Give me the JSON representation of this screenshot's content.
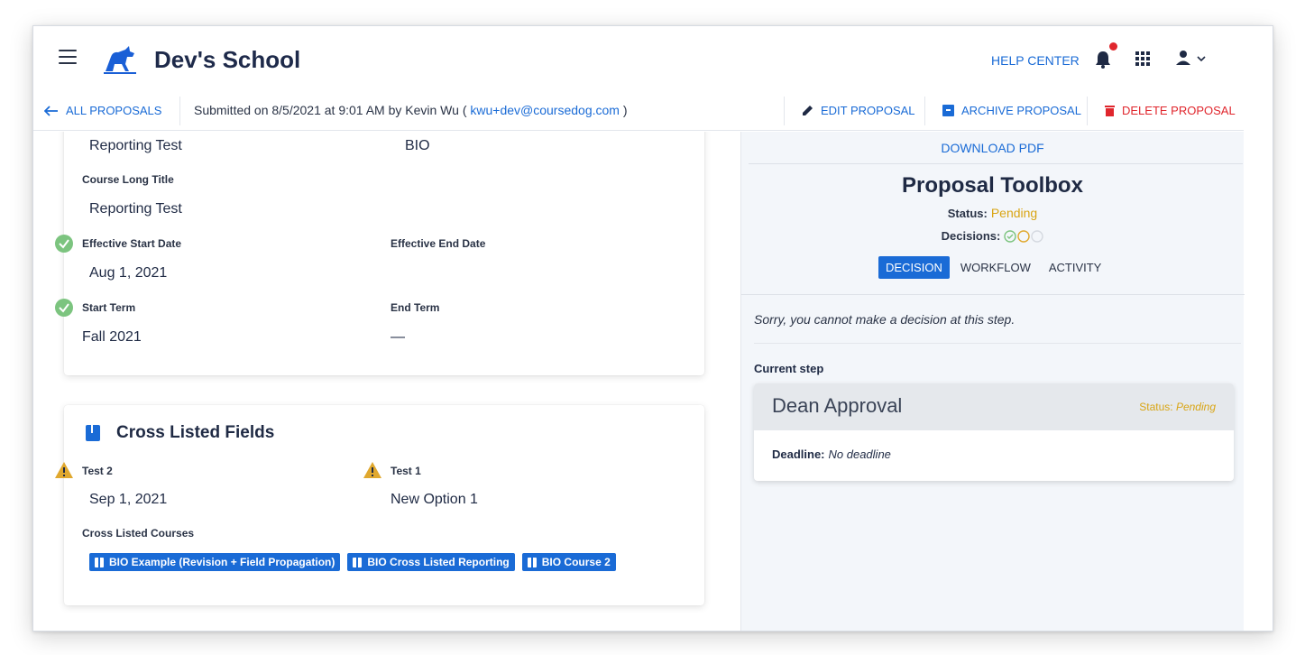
{
  "header": {
    "school_name": "Dev's School",
    "help_center": "HELP CENTER"
  },
  "action_bar": {
    "back_label": "ALL PROPOSALS",
    "submitted_prefix": "Submitted on 8/5/2021 at 9:01 AM by Kevin Wu (",
    "submitted_email": " kwu+dev@coursedog.com ",
    "submitted_suffix": ")",
    "edit_label": "EDIT PROPOSAL",
    "archive_label": "ARCHIVE PROPOSAL",
    "delete_label": "DELETE PROPOSAL"
  },
  "course_card": {
    "title_value": "Reporting Test",
    "subject_value": "BIO",
    "long_title_label": "Course Long Title",
    "long_title_value": "Reporting Test",
    "eff_start_label": "Effective Start Date",
    "eff_start_value": "Aug 1, 2021",
    "eff_end_label": "Effective End Date",
    "start_term_label": "Start Term",
    "start_term_value": "Fall 2021",
    "end_term_label": "End Term",
    "end_term_value": "—"
  },
  "cross_listed": {
    "title": "Cross Listed Fields",
    "test2_label": "Test 2",
    "test2_value": "Sep 1, 2021",
    "test1_label": "Test 1",
    "test1_value": "New Option 1",
    "courses_label": "Cross Listed Courses",
    "courses": [
      "BIO Example (Revision + Field Propagation)",
      "BIO Cross Listed Reporting",
      "BIO Course 2"
    ]
  },
  "toolbox": {
    "download": "DOWNLOAD PDF",
    "title": "Proposal Toolbox",
    "status_label": "Status:",
    "status_value": "Pending",
    "decisions_label": "Decisions:",
    "tabs": [
      "DECISION",
      "WORKFLOW",
      "ACTIVITY"
    ],
    "sorry": "Sorry, you cannot make a decision at this step.",
    "current_step_label": "Current step",
    "step_name": "Dean Approval",
    "step_status_label": "Status:",
    "step_status_value": "Pending",
    "deadline_label": "Deadline:",
    "deadline_value": "No deadline"
  },
  "colors": {
    "accent": "#1a6bd6",
    "pending": "#d9a514",
    "danger": "#e0262d",
    "success": "#7cc47f",
    "warning": "#e0a82e"
  }
}
